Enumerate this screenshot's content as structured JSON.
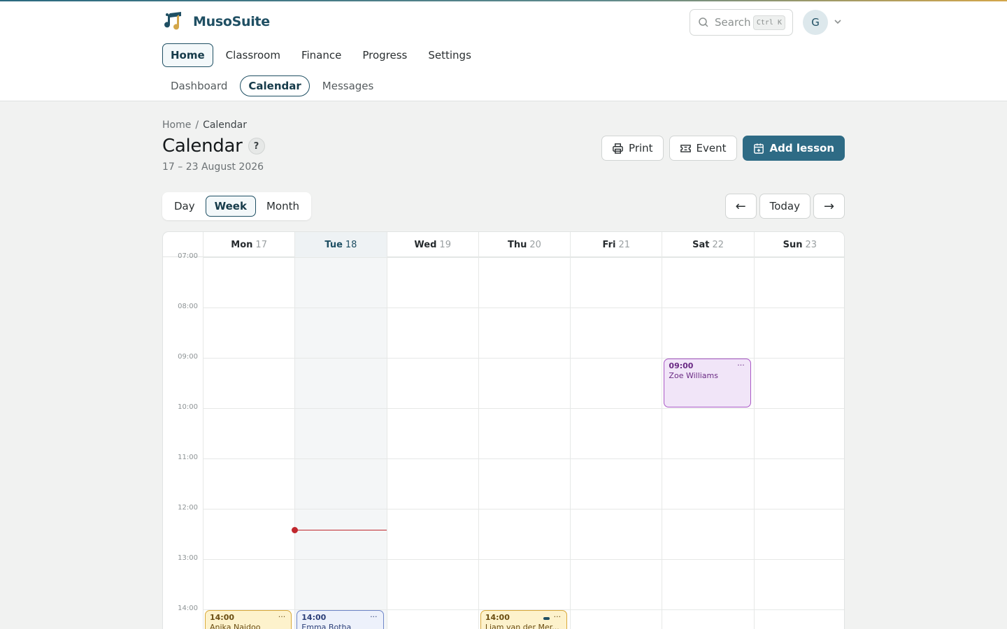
{
  "app": {
    "brand": "MusoSuite"
  },
  "search": {
    "placeholder": "Search",
    "shortcut": "Ctrl K"
  },
  "user": {
    "initial": "G"
  },
  "main_nav": [
    {
      "label": "Home",
      "active": true
    },
    {
      "label": "Classroom",
      "active": false
    },
    {
      "label": "Finance",
      "active": false
    },
    {
      "label": "Progress",
      "active": false
    },
    {
      "label": "Settings",
      "active": false
    }
  ],
  "sub_nav": [
    {
      "label": "Dashboard",
      "active": false
    },
    {
      "label": "Calendar",
      "active": true
    },
    {
      "label": "Messages",
      "active": false
    }
  ],
  "breadcrumb": {
    "parent": "Home",
    "separator": "/",
    "current": "Calendar"
  },
  "page": {
    "title": "Calendar",
    "help": "?",
    "date_range": "17 – 23 August 2026"
  },
  "actions": {
    "print": "Print",
    "event": "Event",
    "add_lesson": "Add lesson"
  },
  "view_toggle": [
    {
      "label": "Day",
      "active": false
    },
    {
      "label": "Week",
      "active": true
    },
    {
      "label": "Month",
      "active": false
    }
  ],
  "navigation": {
    "prev": "←",
    "today": "Today",
    "next": "→"
  },
  "calendar": {
    "days": [
      {
        "name": "Mon",
        "num": "17",
        "today": false
      },
      {
        "name": "Tue",
        "num": "18",
        "today": true
      },
      {
        "name": "Wed",
        "num": "19",
        "today": false
      },
      {
        "name": "Thu",
        "num": "20",
        "today": false
      },
      {
        "name": "Fri",
        "num": "21",
        "today": false
      },
      {
        "name": "Sat",
        "num": "22",
        "today": false
      },
      {
        "name": "Sun",
        "num": "23",
        "today": false
      }
    ],
    "hours": [
      "07:00",
      "08:00",
      "09:00",
      "10:00",
      "11:00",
      "12:00",
      "13:00",
      "14:00"
    ],
    "now": {
      "day_index": 1,
      "hour": 12.42
    },
    "events": [
      {
        "day_index": 5,
        "start": 9.0,
        "end": 10.0,
        "time": "09:00",
        "name": "Zoe Williams",
        "color": "purple",
        "more": "···",
        "pill": false
      },
      {
        "day_index": 0,
        "start": 14.0,
        "end": 15.0,
        "time": "14:00",
        "name": "Anika Naidoo",
        "color": "yellow",
        "more": "···",
        "pill": false
      },
      {
        "day_index": 1,
        "start": 14.0,
        "end": 15.0,
        "time": "14:00",
        "name": "Emma Botha",
        "color": "blue",
        "more": "···",
        "pill": false
      },
      {
        "day_index": 3,
        "start": 14.0,
        "end": 15.0,
        "time": "14:00",
        "name": "Liam van der Mer...",
        "color": "yellow",
        "more": "···",
        "pill": true
      }
    ]
  },
  "colors": {
    "accent": "#2e6b85",
    "now_line": "#c0272d"
  }
}
